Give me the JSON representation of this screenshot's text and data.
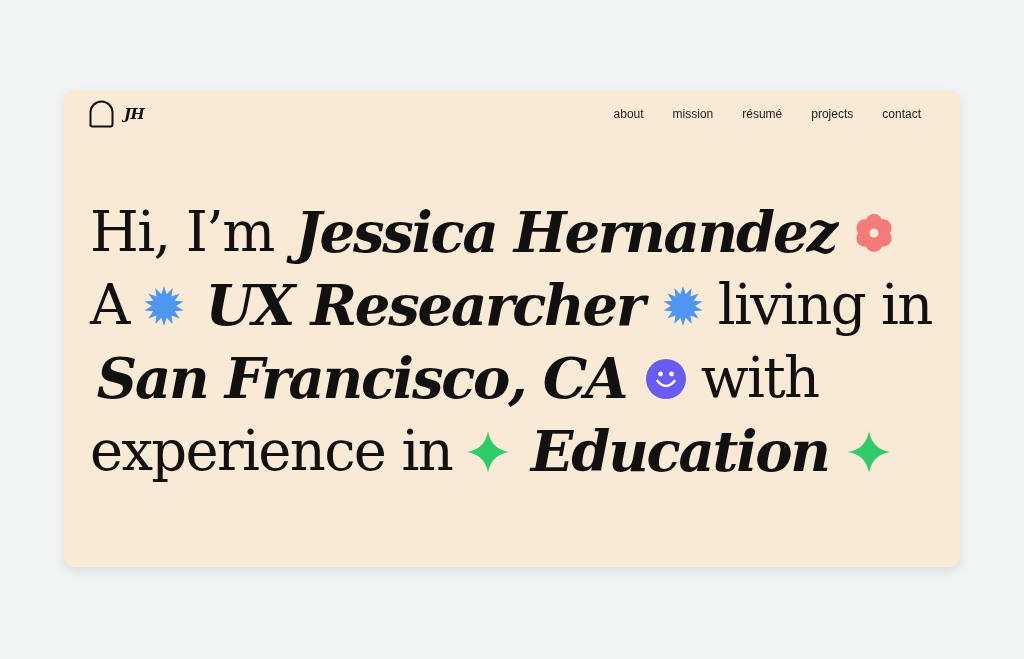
{
  "header": {
    "logo": "JH",
    "nav": [
      "about",
      "mission",
      "résumé",
      "projects",
      "contact"
    ]
  },
  "headline": {
    "lines": [
      {
        "segments": [
          {
            "kind": "text",
            "text": "Hi, I’m"
          },
          {
            "kind": "emphasis",
            "text": "Jessica Hernandez"
          },
          {
            "kind": "flower",
            "color": "#f57a7a"
          }
        ]
      },
      {
        "segments": [
          {
            "kind": "text",
            "text": "A"
          },
          {
            "kind": "burst",
            "color": "#4d97f0"
          },
          {
            "kind": "emphasis",
            "text": "UX Researcher"
          },
          {
            "kind": "burst",
            "color": "#4d97f0"
          },
          {
            "kind": "text",
            "text": "living in"
          }
        ]
      },
      {
        "segments": [
          {
            "kind": "emphasis",
            "text": "San Francisco, CA"
          },
          {
            "kind": "smiley",
            "color": "#6a5cf0"
          },
          {
            "kind": "text",
            "text": "with"
          }
        ]
      },
      {
        "segments": [
          {
            "kind": "text",
            "text": "experience in"
          },
          {
            "kind": "sparkle",
            "color": "#2ecb6b"
          },
          {
            "kind": "emphasis",
            "text": "Education"
          },
          {
            "kind": "sparkle",
            "color": "#2ecb6b"
          }
        ]
      }
    ]
  }
}
